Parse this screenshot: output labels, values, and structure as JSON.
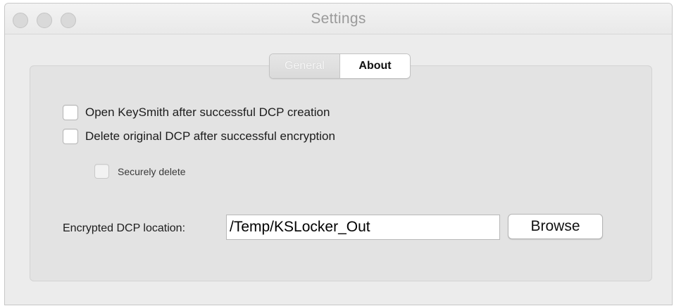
{
  "window": {
    "title": "Settings"
  },
  "tabs": [
    {
      "label": "General",
      "selected": false
    },
    {
      "label": "About",
      "selected": true
    }
  ],
  "options": [
    {
      "label": "Open KeySmith after successful DCP creation",
      "checked": false
    },
    {
      "label": "Delete original DCP after successful encryption",
      "checked": false
    }
  ],
  "suboption": {
    "label": "Securely delete",
    "checked": false,
    "enabled": false
  },
  "location": {
    "label": "Encrypted DCP location:",
    "value": "/Temp/KSLocker_Out",
    "browse_label": "Browse"
  }
}
